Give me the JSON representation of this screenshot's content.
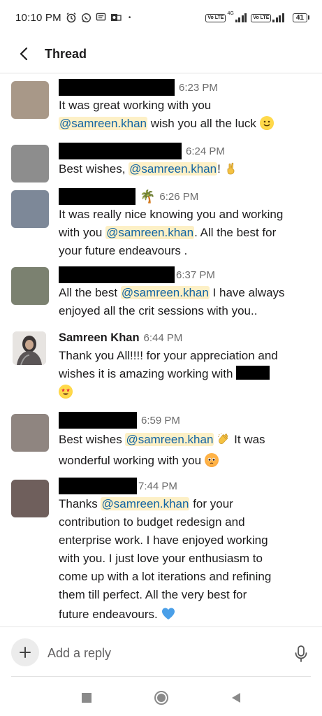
{
  "status_bar": {
    "time": "10:10 PM",
    "network_1": "Vo LTE",
    "network_2": "Vo LTE",
    "network_type": "4G",
    "battery": "41"
  },
  "header": {
    "title": "Thread"
  },
  "messages": [
    {
      "time": "6:23 PM",
      "avatar_color": "#a89888",
      "line1": "It was great working with you",
      "mention": "@samreen.khan",
      "after": " wish you all the luck ",
      "emoji": "slightly-smiling-face"
    },
    {
      "time": "6:24 PM",
      "avatar_color": "#8d8d8d",
      "before": "Best wishes, ",
      "mention": "@samreen.khan",
      "after": "! ",
      "emoji": "fingers-crossed"
    },
    {
      "time": "6:26 PM",
      "avatar_color": "#7d8898",
      "status_emoji": "🌴",
      "line1": "It was really nice knowing you and working",
      "before": "with you ",
      "mention": "@samreen.khan",
      "after": ". All the best for",
      "line3": "your future endeavours ."
    },
    {
      "time": "6:37 PM",
      "avatar_color": "#7b8170",
      "before": "All the best ",
      "mention": "@samreen.khan",
      "after": " I have always",
      "line2": "enjoyed all the crit sessions with you.."
    },
    {
      "sender": "Samreen Khan",
      "time": "6:44 PM",
      "line1": "Thank you All!!!! for your appreciation and",
      "line2": "wishes it is amazing working with ",
      "emoji": "star-struck"
    },
    {
      "time": "6:59 PM",
      "avatar_color": "#8f8580",
      "before": "Best wishes ",
      "mention": "@samreen.khan",
      "after": " It was",
      "line2": "wonderful working with you ",
      "emoji1": "clapping-hands",
      "emoji2": "pleading-face"
    },
    {
      "time": "7:44 PM",
      "avatar_color": "#6f5f5c",
      "before": "Thanks ",
      "mention": "@samreen.khan",
      "after": " for your",
      "line2": "contribution to budget redesign and",
      "line3": "enterprise work. I have enjoyed working",
      "line4": "with you. I just love your enthusiasm to",
      "line5": "come up with a lot iterations and refining",
      "line6": "them till perfect. All the very best for",
      "line7": "future endeavours. ",
      "emoji": "blue-heart"
    }
  ],
  "composer": {
    "placeholder": "Add a reply"
  },
  "colors": {
    "mention_bg": "#fdf0c6",
    "mention_text": "#1264a3",
    "heart": "#4a9fe8"
  }
}
